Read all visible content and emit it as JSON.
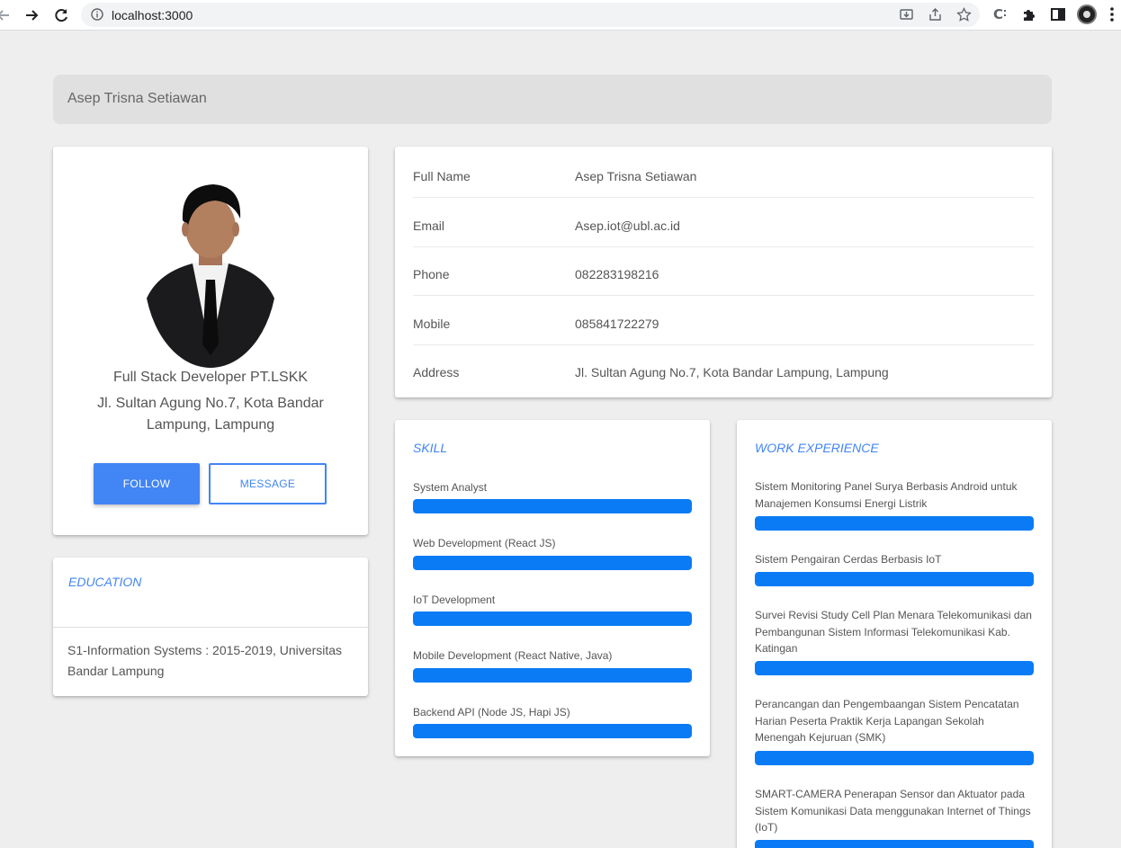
{
  "browser": {
    "url": "localhost:3000"
  },
  "header": {
    "title": "Asep Trisna Setiawan"
  },
  "profile": {
    "role": "Full Stack Developer PT.LSKK",
    "address": "Jl. Sultan Agung No.7, Kota Bandar Lampung, Lampung",
    "follow_label": "FOLLOW",
    "message_label": "MESSAGE"
  },
  "education": {
    "title": "EDUCATION",
    "text": "S1-Information Systems : 2015-2019, Universitas Bandar Lampung"
  },
  "info": {
    "rows": [
      {
        "label": "Full Name",
        "value": "Asep Trisna Setiawan"
      },
      {
        "label": "Email",
        "value": "Asep.iot@ubl.ac.id"
      },
      {
        "label": "Phone",
        "value": "082283198216"
      },
      {
        "label": "Mobile",
        "value": "085841722279"
      },
      {
        "label": "Address",
        "value": "Jl. Sultan Agung No.7, Kota Bandar Lampung, Lampung"
      }
    ]
  },
  "skill": {
    "title": "SKILL",
    "items": [
      {
        "name": "System Analyst",
        "progress": 1.0
      },
      {
        "name": "Web Development (React JS)",
        "progress": 1.0
      },
      {
        "name": "IoT Development",
        "progress": 1.0
      },
      {
        "name": "Mobile Development (React Native, Java)",
        "progress": 1.0
      },
      {
        "name": "Backend API (Node JS, Hapi JS)",
        "progress": 1.0
      }
    ]
  },
  "work": {
    "title": "WORK EXPERIENCE",
    "items": [
      {
        "name": "Sistem Monitoring Panel Surya Berbasis Android untuk Manajemen Konsumsi Energi Listrik",
        "progress": 1.0
      },
      {
        "name": "Sistem Pengairan Cerdas Berbasis IoT",
        "progress": 1.0
      },
      {
        "name": "Survei Revisi Study Cell Plan Menara Telekomunikasi dan Pembangunan Sistem Informasi Telekomunikasi Kab. Katingan",
        "progress": 1.0
      },
      {
        "name": "Perancangan dan Pengembaangan Sistem Pencatatan Harian Peserta Praktik Kerja Lapangan Sekolah Menengah Kejuruan (SMK)",
        "progress": 1.0
      },
      {
        "name": "SMART-CAMERA Penerapan Sensor dan Aktuator pada Sistem Komunikasi Data menggunakan Internet of Things (IoT)",
        "progress": 1.0
      }
    ]
  },
  "colors": {
    "accent": "#4285f4",
    "bar": "#0a7bf5",
    "background": "#eeeeee"
  }
}
